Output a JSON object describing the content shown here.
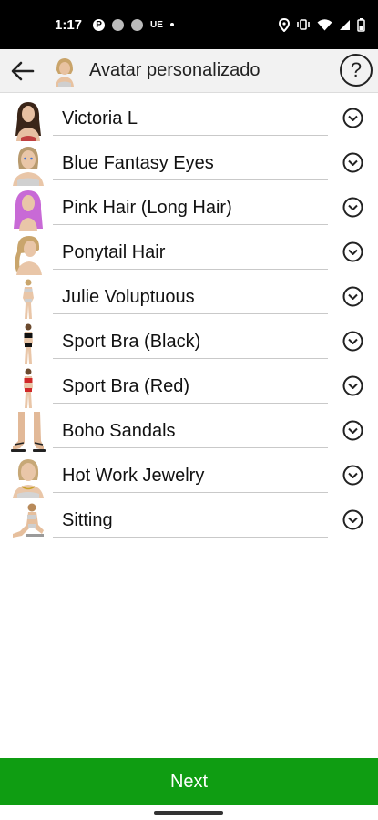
{
  "status_bar": {
    "time": "1:17",
    "left_icons": [
      "p-icon",
      "moon-icon",
      "moon-icon"
    ],
    "carrier_text": "UE",
    "right_icons": [
      "location-icon",
      "vibrate-icon",
      "wifi-icon",
      "signal-icon",
      "battery-icon"
    ]
  },
  "app_bar": {
    "title": "Avatar personalizado",
    "help_label": "?",
    "icons": [
      "back-arrow-icon",
      "avatar-icon",
      "help-icon"
    ]
  },
  "items": [
    {
      "label": "Victoria L",
      "thumb": "victoria-l-thumb",
      "action_icon": "chevron-down-circle-icon"
    },
    {
      "label": "Blue Fantasy Eyes",
      "thumb": "blue-fantasy-eyes-thumb",
      "action_icon": "chevron-down-circle-icon"
    },
    {
      "label": "Pink Hair (Long Hair)",
      "thumb": "pink-hair-thumb",
      "action_icon": "chevron-down-circle-icon"
    },
    {
      "label": "Ponytail Hair",
      "thumb": "ponytail-hair-thumb",
      "action_icon": "chevron-down-circle-icon"
    },
    {
      "label": "Julie Voluptuous",
      "thumb": "julie-voluptuous-thumb",
      "action_icon": "chevron-down-circle-icon"
    },
    {
      "label": "Sport Bra (Black)",
      "thumb": "sport-bra-black-thumb",
      "action_icon": "chevron-down-circle-icon"
    },
    {
      "label": "Sport Bra (Red)",
      "thumb": "sport-bra-red-thumb",
      "action_icon": "chevron-down-circle-icon"
    },
    {
      "label": "Boho Sandals",
      "thumb": "boho-sandals-thumb",
      "action_icon": "chevron-down-circle-icon"
    },
    {
      "label": "Hot Work Jewelry",
      "thumb": "hot-work-jewelry-thumb",
      "action_icon": "chevron-down-circle-icon"
    },
    {
      "label": "Sitting",
      "thumb": "sitting-thumb",
      "action_icon": "chevron-down-circle-icon"
    }
  ],
  "next_button": {
    "label": "Next"
  },
  "colors": {
    "accent_green": "#0f9d12",
    "app_bar_bg": "#f2f2f2",
    "status_bar_bg": "#000000"
  }
}
